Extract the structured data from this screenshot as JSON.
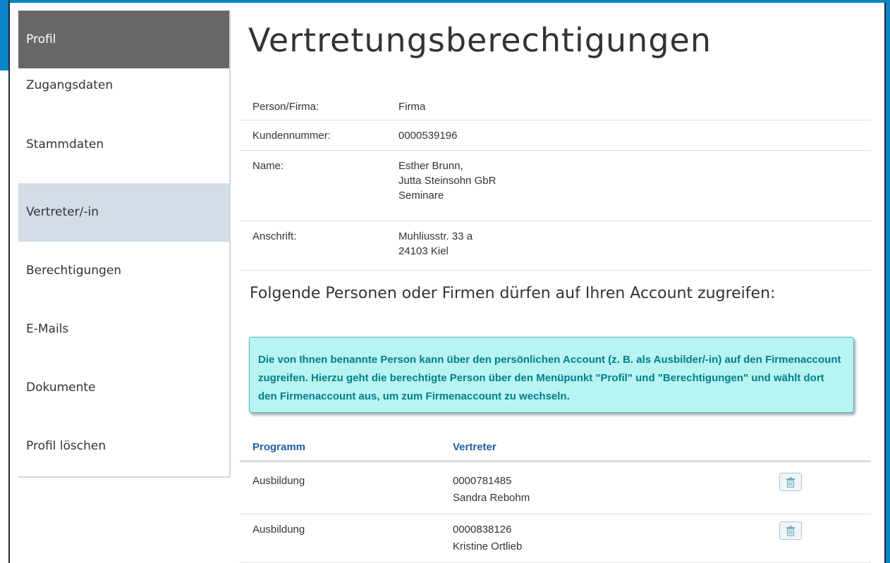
{
  "sidebar": {
    "items": [
      {
        "label": "Profil",
        "state": "header"
      },
      {
        "label": "Zugangsdaten"
      },
      {
        "label": "Stammdaten"
      },
      {
        "label": "Vertreter/-in",
        "state": "selected"
      },
      {
        "label": "Berechtigungen"
      },
      {
        "label": "E-Mails"
      },
      {
        "label": "Dokumente"
      },
      {
        "label": "Profil löschen"
      }
    ]
  },
  "main": {
    "title": "Vertretungsberechtigungen",
    "info": {
      "person": {
        "label": "Person/Firma:",
        "value": "Firma"
      },
      "kunde": {
        "label": "Kundennummer:",
        "value": "0000539196"
      },
      "name": {
        "label": "Name:",
        "lines": [
          "Esther Brunn,",
          "Jutta Steinsohn GbR",
          "Seminare"
        ]
      },
      "anschrift": {
        "label": "Anschrift:",
        "lines": [
          "Muhliusstr. 33 a",
          "24103 Kiel"
        ]
      }
    },
    "section_heading": "Folgende Personen oder Firmen dürfen auf Ihren Account zugreifen:",
    "notice": "Die von Ihnen benannte Person kann über den persönlichen Account (z. B. als Ausbilder/-in) auf den Firmenaccount zugreifen. Hierzu geht die berechtigte Person über den Menüpunkt \"Profil\" und \"Berechtigungen\" und wählt dort den Firmenaccount aus, um zum Firmenaccount zu wechseln.",
    "table": {
      "headers": {
        "program": "Programm",
        "representative": "Vertreter"
      },
      "rows": [
        {
          "program": "Ausbildung",
          "number": "0000781485",
          "name": "Sandra Rebohm",
          "action_icon": "trash-icon"
        },
        {
          "program": "Ausbildung",
          "number": "0000838126",
          "name": "Kristine Ortlieb",
          "action_icon": "trash-icon"
        }
      ]
    }
  },
  "colors": {
    "accent_frame": "#0a84c6",
    "nav_header_bg": "#676767",
    "nav_selected_bg": "#d4dde6",
    "notice_bg": "#b8f4f2",
    "notice_text": "#007f8a",
    "table_header_text": "#1f5fa7"
  }
}
